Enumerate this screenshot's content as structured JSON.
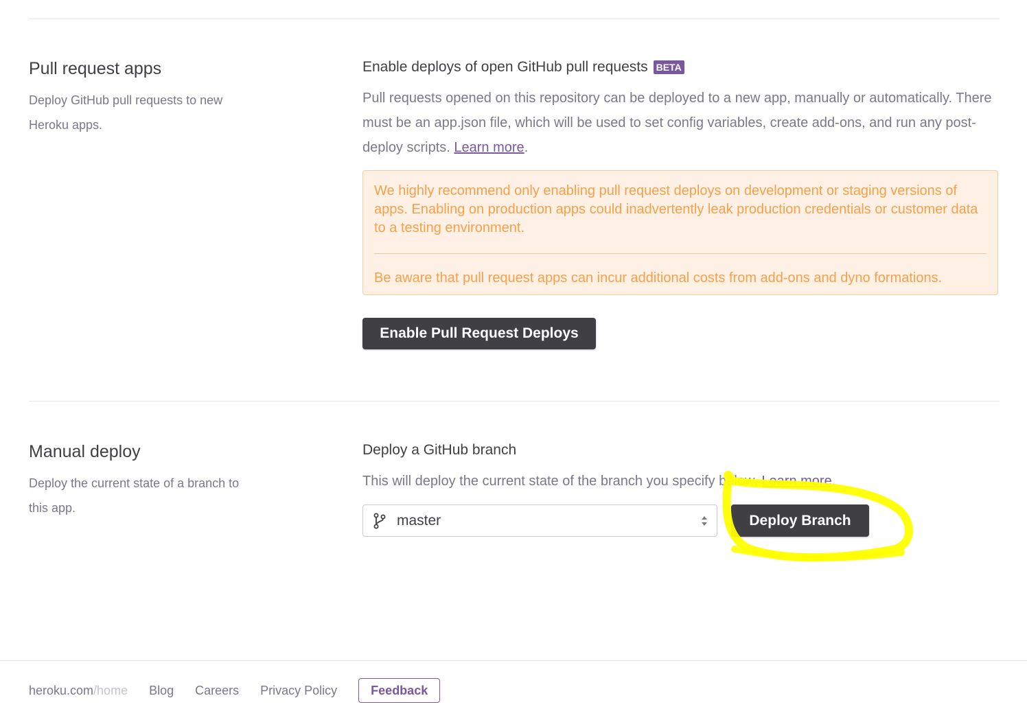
{
  "pull_request_apps": {
    "title": "Pull request apps",
    "description": "Deploy GitHub pull requests to new Heroku apps.",
    "heading": "Enable deploys of open GitHub pull requests",
    "badge": "BETA",
    "body_text": "Pull requests opened on this repository can be deployed to a new app, manually or automatically. There must be an app.json file, which will be used to set config variables, create add-ons, and run any post-deploy scripts.",
    "learn_more": "Learn more",
    "warning_1": "We highly recommend only enabling pull request deploys on development or staging versions of apps. Enabling on production apps could inadvertently leak production credentials or customer data to a testing environment.",
    "warning_2": "Be aware that pull request apps can incur additional costs from add-ons and dyno formations.",
    "enable_button": "Enable Pull Request Deploys"
  },
  "manual_deploy": {
    "title": "Manual deploy",
    "description": "Deploy the current state of a branch to this app.",
    "heading": "Deploy a GitHub branch",
    "body_text": "This will deploy the current state of the branch you specify below.",
    "learn_more": "Learn more",
    "branch_select": {
      "value": "master",
      "icon": "git-branch-icon"
    },
    "deploy_button": "Deploy Branch"
  },
  "footer": {
    "home_domain": "heroku.com",
    "home_path": "/home",
    "links": [
      "Blog",
      "Careers",
      "Privacy Policy"
    ],
    "feedback": "Feedback"
  },
  "colors": {
    "brand_purple": "#79589f",
    "dark_button": "#3f3f44",
    "warning_text": "#f4a14a",
    "warning_bg": "#fef0e4",
    "highlight": "#ffff00"
  }
}
